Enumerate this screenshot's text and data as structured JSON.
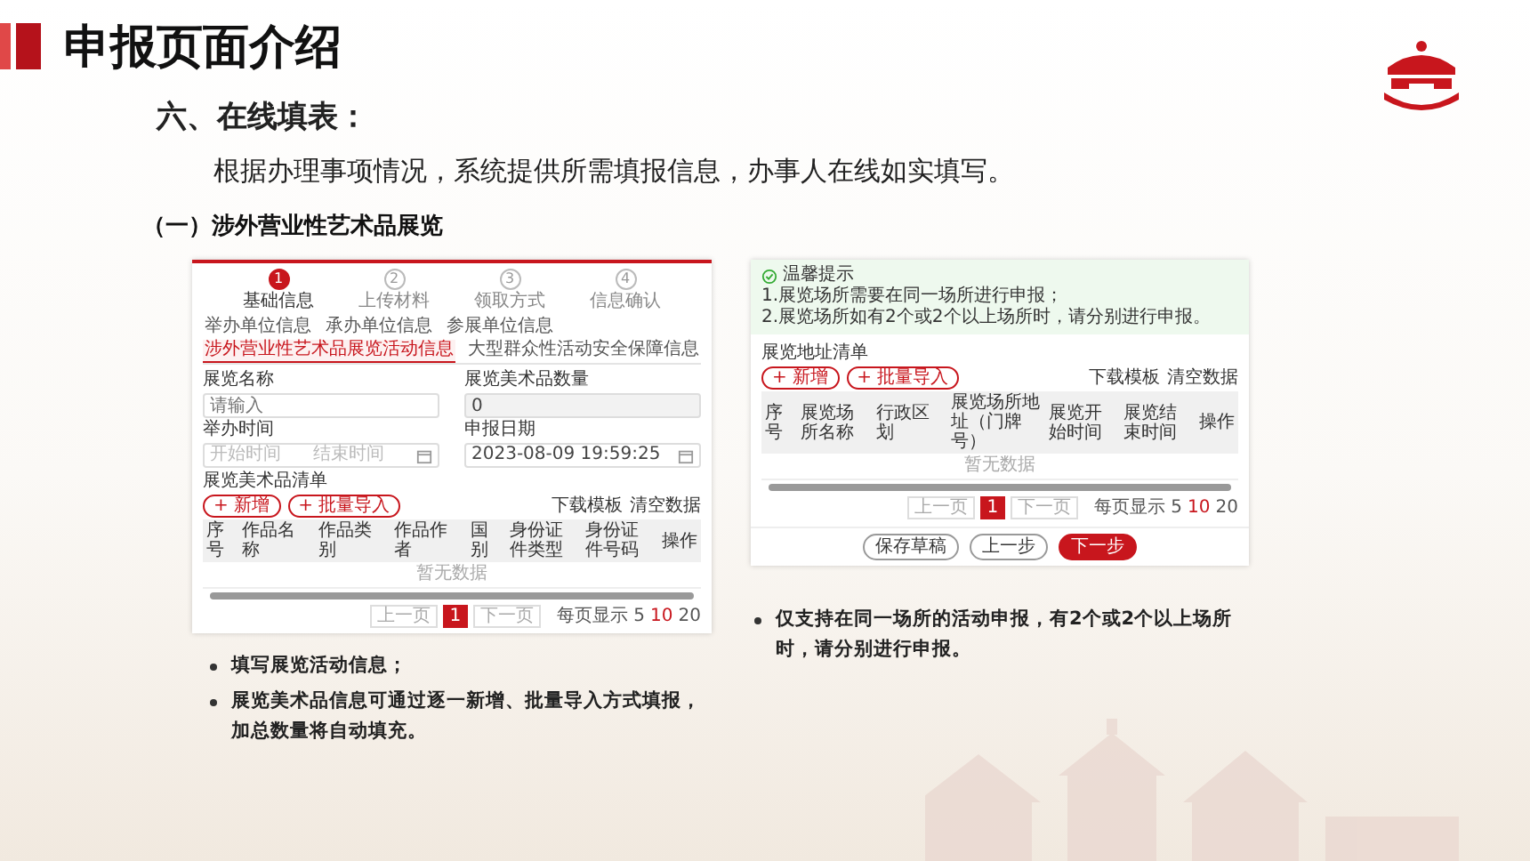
{
  "title": "申报页面介绍",
  "section": "六、在线填表：",
  "intro": "根据办理事项情况，系统提供所需填报信息，办事人在线如实填写。",
  "subsection": "（一）涉外营业性艺术品展览",
  "form_screenshot": {
    "steps": [
      {
        "number": "1",
        "label": "基础信息",
        "selected": true
      },
      {
        "number": "2",
        "label": "上传材料",
        "selected": false
      },
      {
        "number": "3",
        "label": "领取方式",
        "selected": false
      },
      {
        "number": "4",
        "label": "信息确认",
        "selected": false
      }
    ],
    "tabs": [
      {
        "label": "举办单位信息",
        "selected": false
      },
      {
        "label": "承办单位信息",
        "selected": false
      },
      {
        "label": "参展单位信息",
        "selected": false
      },
      {
        "label": "涉外营业性艺术品展览活动信息",
        "selected": true
      },
      {
        "label": "大型群众性活动安全保障信息",
        "selected": false
      }
    ],
    "fields": [
      {
        "label": "展览名称",
        "placeholder": "请输入",
        "kind": "text",
        "disabled": false
      },
      {
        "label": "展览美术品数量",
        "value": "0",
        "kind": "text",
        "disabled": true
      },
      {
        "label": "举办时间",
        "placeholder": "开始时间",
        "placeholder_end": "结束时间",
        "kind": "range",
        "disabled": false
      },
      {
        "label": "申报日期",
        "value": "2023-08-09 19:59:25",
        "kind": "date",
        "disabled": false
      }
    ],
    "list_title": "展览美术品清单",
    "actions": [
      "+ 新增",
      "+ 批量导入"
    ],
    "links": [
      "下载模板",
      "清空数据"
    ],
    "columns": [
      "序号",
      "作品名称",
      "作品类别",
      "作品作者",
      "国别",
      "身份证件类型",
      "身份证件号码",
      "操作"
    ],
    "empty": "暂无数据",
    "pagination": {
      "prev": "上一页",
      "pages": [
        {
          "label": "1",
          "selected": true
        }
      ],
      "next": "下一页",
      "size_label": "每页显示",
      "sizes": [
        {
          "label": "5",
          "selected": false
        },
        {
          "label": "10",
          "selected": true
        },
        {
          "label": "20",
          "selected": false
        }
      ]
    }
  },
  "venue_screenshot": {
    "notice": {
      "title": "温馨提示",
      "lines": [
        "1.展览场所需要在同一场所进行申报；",
        "2.展览场所如有2个或2个以上场所时，请分别进行申报。"
      ]
    },
    "list_title": "展览地址清单",
    "actions": [
      "+ 新增",
      "+ 批量导入"
    ],
    "links": [
      "下载模板",
      "清空数据"
    ],
    "columns": [
      "序号",
      "展览场所名称",
      "行政区划",
      "展览场所地址（门牌号）",
      "展览开始时间",
      "展览结束时间",
      "操作"
    ],
    "empty": "暂无数据",
    "pagination": {
      "prev": "上一页",
      "pages": [
        {
          "label": "1",
          "selected": true
        }
      ],
      "next": "下一页",
      "size_label": "每页显示",
      "sizes": [
        {
          "label": "5",
          "selected": false
        },
        {
          "label": "10",
          "selected": true
        },
        {
          "label": "20",
          "selected": false
        }
      ]
    },
    "buttons": [
      {
        "label": "保存草稿",
        "kind": "outline"
      },
      {
        "label": "上一步",
        "kind": "outline"
      },
      {
        "label": "下一步",
        "kind": "primary"
      }
    ]
  },
  "notes_left": [
    "填写展览活动信息；",
    "展览美术品信息可通过逐一新增、批量导入方式填报，加总数量将自动填充。"
  ],
  "notes_right": [
    "仅支持在同一场所的活动申报，有2个或2个以上场所时，请分别进行申报。"
  ]
}
